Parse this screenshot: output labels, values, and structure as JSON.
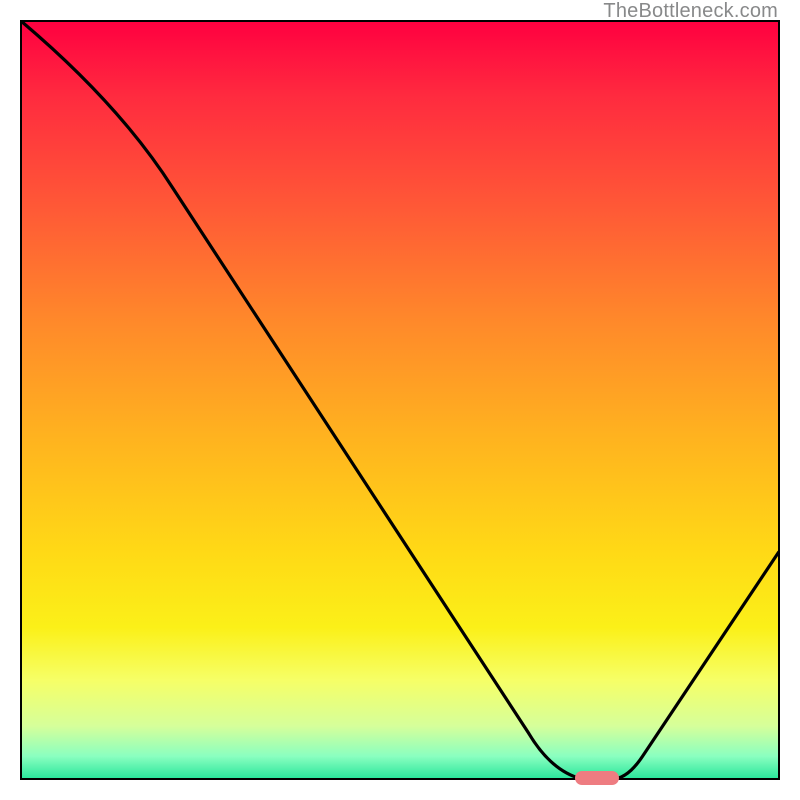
{
  "watermark": "TheBottleneck.com",
  "chart_data": {
    "type": "line",
    "title": "",
    "xlabel": "",
    "ylabel": "",
    "xlim": [
      0,
      100
    ],
    "ylim": [
      0,
      100
    ],
    "x": [
      0,
      20,
      70,
      74,
      78,
      100
    ],
    "y": [
      100,
      78,
      3,
      0,
      0,
      30
    ],
    "minimum_marker": {
      "x": 76,
      "y": 0
    },
    "grid": false,
    "legend": false,
    "background": "vertical-gradient red→yellow→green"
  },
  "colors": {
    "curve": "#000000",
    "marker": "#ee7c81",
    "frame": "#000000",
    "watermark": "#88898a"
  }
}
